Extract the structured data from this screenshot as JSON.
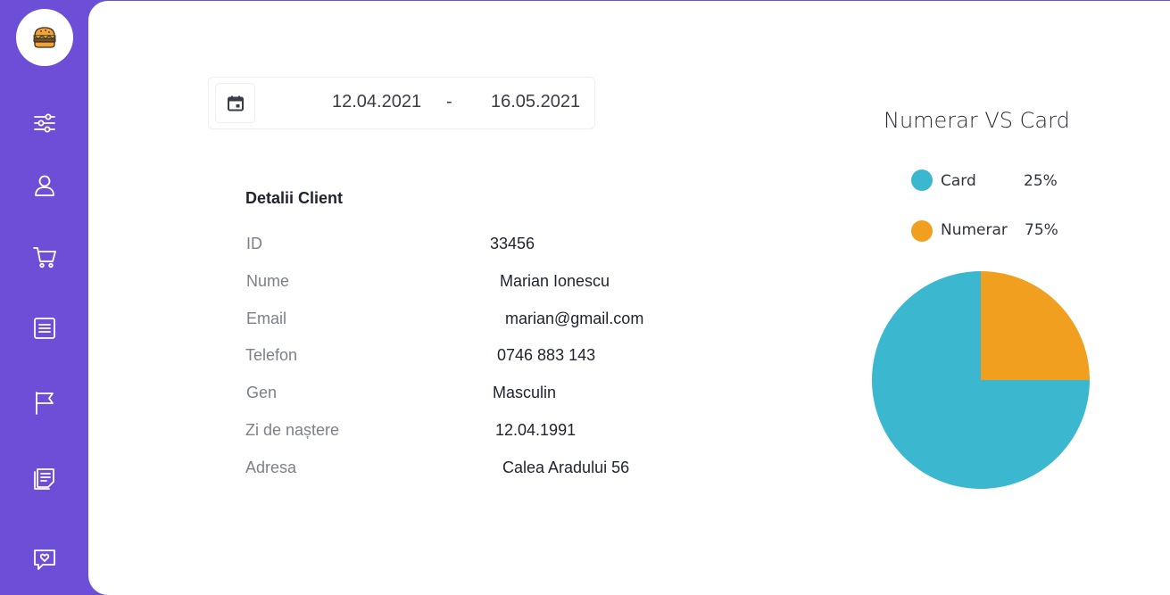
{
  "sidebar": {
    "logo_icon": "burger-icon",
    "items": [
      {
        "icon": "sliders-icon",
        "label": "Filters"
      },
      {
        "icon": "user-icon",
        "label": "Clients"
      },
      {
        "icon": "cart-icon",
        "label": "Orders"
      },
      {
        "icon": "list-icon",
        "label": "Menu"
      },
      {
        "icon": "flag-icon",
        "label": "Reports"
      },
      {
        "icon": "notes-icon",
        "label": "Notes"
      },
      {
        "icon": "feedback-icon",
        "label": "Feedback"
      }
    ]
  },
  "daterange": {
    "calendar_icon": "calendar-icon",
    "from": "12.04.2021",
    "separator": "-",
    "to": "16.05.2021"
  },
  "client": {
    "title": "Detalii Client",
    "rows": [
      {
        "label": "ID",
        "value": "33456"
      },
      {
        "label": "Nume",
        "value": "Marian Ionescu"
      },
      {
        "label": "Email",
        "value": "marian@gmail.com"
      },
      {
        "label": "Telefon",
        "value": "0746 883 143"
      },
      {
        "label": "Gen",
        "value": "Masculin"
      },
      {
        "label": "Zi de naștere",
        "value": "12.04.1991"
      },
      {
        "label": "Adresa",
        "value": "Calea Aradului 56"
      }
    ]
  },
  "chart_data": {
    "type": "pie",
    "title": "Numerar VS Card",
    "legend_position": "top",
    "slices": [
      {
        "name": "Card",
        "label": "25%",
        "value": 25,
        "color": "#3bb7cf"
      },
      {
        "name": "Numerar",
        "label": "75%",
        "value": 75,
        "color": "#f09f1e"
      }
    ]
  },
  "colors": {
    "sidebar": "#6c4fd6",
    "card": "#3bb7cf",
    "numerar": "#f09f1e"
  }
}
